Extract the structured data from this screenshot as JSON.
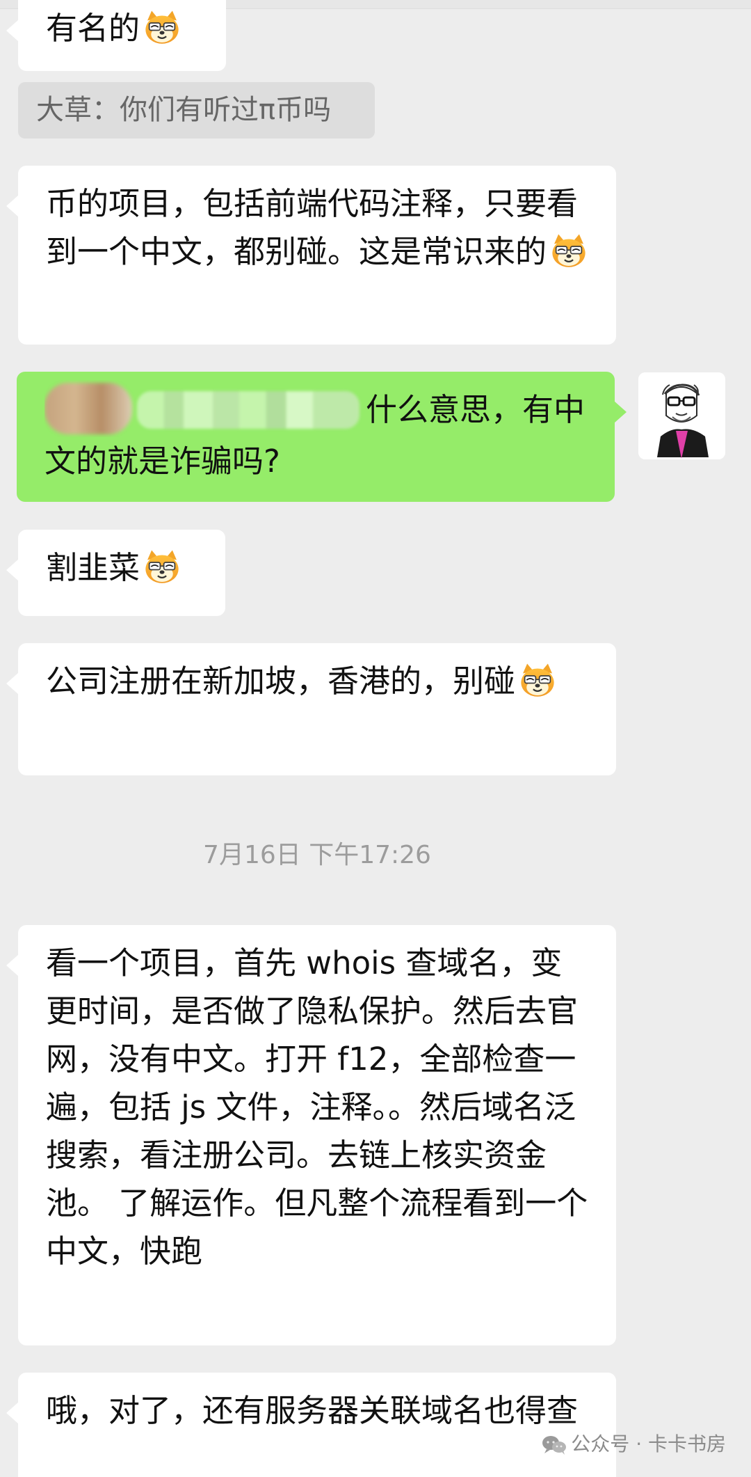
{
  "messages": {
    "top_bubble": "有名的",
    "quote": "大草：你们有听过π币吗",
    "msg1": "币的项目，包括前端代码注释，只要看到一个中文，都别碰。这是常识来的",
    "my_msg": "什么意思，有中文的就是诈骗吗?",
    "msg2": "割韭菜",
    "msg3": "公司注册在新加坡，香港的，别碰",
    "timestamp": "7月16日 下午17:26",
    "msg4": "看一个项目，首先 whois 查域名，变更时间，是否做了隐私保护。然后去官网，没有中文。打开 f12，全部检查一遍，包括 js 文件，注释。。然后域名泛搜索，看注册公司。去链上核实资金池。 了解运作。但凡整个流程看到一个中文，快跑",
    "msg5": "哦，对了，还有服务器关联域名也得查"
  },
  "watermark": {
    "text": "公众号 · 卡卡书房",
    "icon": "wechat-icon"
  },
  "icons": {
    "emoji": "doge-emoji-icon",
    "avatar": "avatar-portrait"
  },
  "colors": {
    "background": "#ededed",
    "left_bubble": "#ffffff",
    "right_bubble": "#95ec69",
    "quote_bg": "#dddddd",
    "timestamp": "#9c9c9c"
  }
}
